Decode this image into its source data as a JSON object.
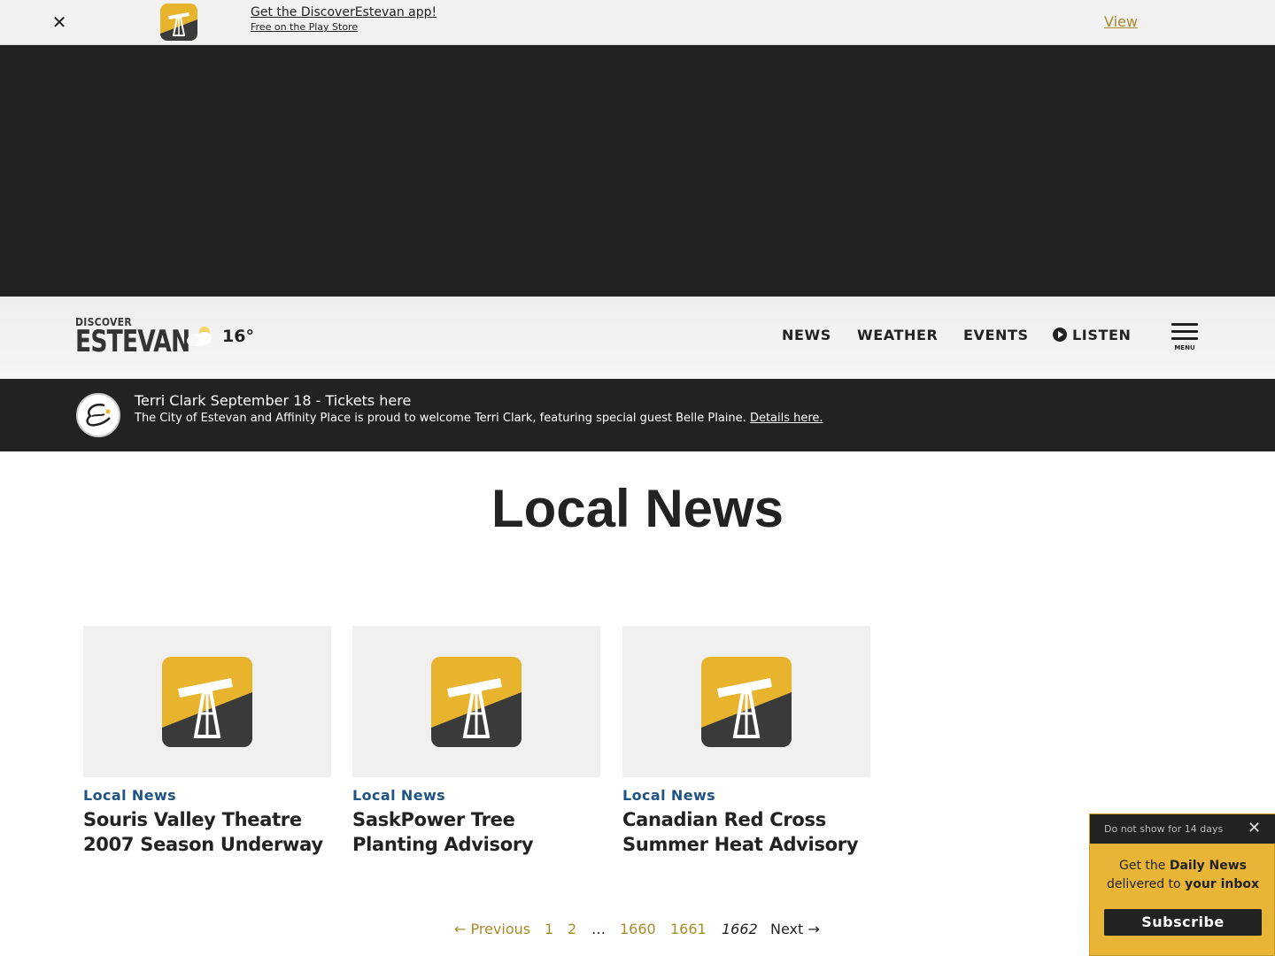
{
  "app_banner": {
    "close_icon": "close-x-icon",
    "title": "Get the DiscoverEstevan app!",
    "subtitle": "Free on the Play Store",
    "view_label": "View"
  },
  "header": {
    "logo_small": "DISCOVER",
    "logo_big": "ESTEVAN",
    "weather_icon": "partly-cloudy-icon",
    "temperature": "16°",
    "nav": [
      "NEWS",
      "WEATHER",
      "EVENTS",
      "LISTEN"
    ],
    "menu_label": "MENU"
  },
  "alert": {
    "title": "Terri Clark September 18 - Tickets here",
    "body": "The City of Estevan and Affinity Place is proud to welcome Terri Clark, featuring special guest Belle Plaine.",
    "link": "Details here."
  },
  "page": {
    "title": "Local News"
  },
  "articles": [
    {
      "category": "Local News",
      "title": "Souris Valley Theatre 2007 Season Underway"
    },
    {
      "category": "Local News",
      "title": "SaskPower Tree Planting Advisory"
    },
    {
      "category": "Local News",
      "title": "Canadian Red Cross Summer Heat Advisory"
    }
  ],
  "pagination": {
    "previous": "← Previous",
    "pages": [
      "1",
      "2"
    ],
    "dots": "…",
    "tail_pages": [
      "1660",
      "1661"
    ],
    "current": "1662",
    "next": "Next →"
  },
  "popup": {
    "dismiss": "Do not show for 14 days",
    "text_prefix": "Get the ",
    "text_bold1": "Daily News",
    "text_mid": "delivered to ",
    "text_bold2": "your inbox",
    "button": "Subscribe"
  },
  "colors": {
    "accent_gold": "#e8b32d",
    "link_gold": "#a88a2a",
    "category_blue": "#1e5383",
    "dark": "#222222"
  }
}
